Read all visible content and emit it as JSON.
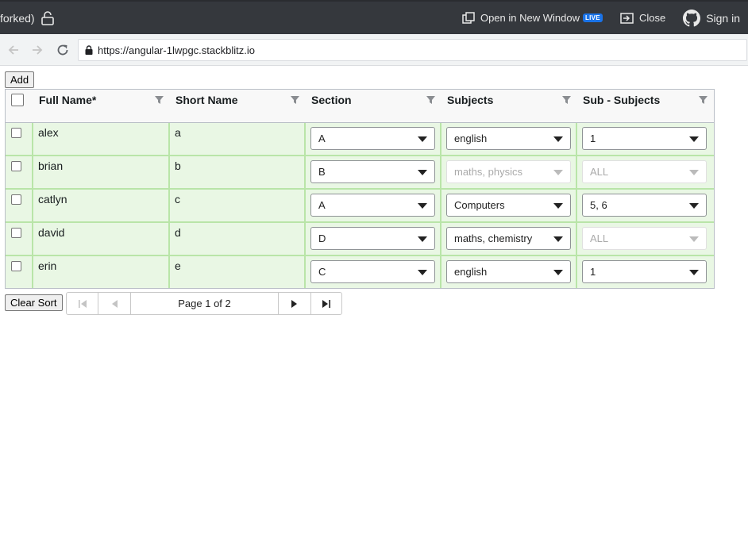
{
  "topbar": {
    "project_suffix": "forked)",
    "open_new_window": "Open in New Window",
    "live_badge": "LIVE",
    "close": "Close",
    "sign_in": "Sign in"
  },
  "browser": {
    "url": "https://angular-1lwpgc.stackblitz.io"
  },
  "buttons": {
    "add": "Add",
    "clear_sort": "Clear Sort"
  },
  "grid": {
    "columns": [
      "Full Name*",
      "Short Name",
      "Section",
      "Subjects",
      "Sub - Subjects"
    ],
    "rows": [
      {
        "full_name": "alex",
        "short_name": "a",
        "section": "A",
        "subjects": "english",
        "subjects_disabled": false,
        "sub_subjects": "1",
        "sub_subjects_disabled": false
      },
      {
        "full_name": "brian",
        "short_name": "b",
        "section": "B",
        "subjects": "maths, physics",
        "subjects_disabled": true,
        "sub_subjects": "ALL",
        "sub_subjects_disabled": true
      },
      {
        "full_name": "catlyn",
        "short_name": "c",
        "section": "A",
        "subjects": "Computers",
        "subjects_disabled": false,
        "sub_subjects": "5, 6",
        "sub_subjects_disabled": false
      },
      {
        "full_name": "david",
        "short_name": "d",
        "section": "D",
        "subjects": "maths, chemistry",
        "subjects_disabled": false,
        "sub_subjects": "ALL",
        "sub_subjects_disabled": true
      },
      {
        "full_name": "erin",
        "short_name": "e",
        "section": "C",
        "subjects": "english",
        "subjects_disabled": false,
        "sub_subjects": "1",
        "sub_subjects_disabled": false
      }
    ]
  },
  "pager": {
    "label": "Page 1 of 2"
  }
}
